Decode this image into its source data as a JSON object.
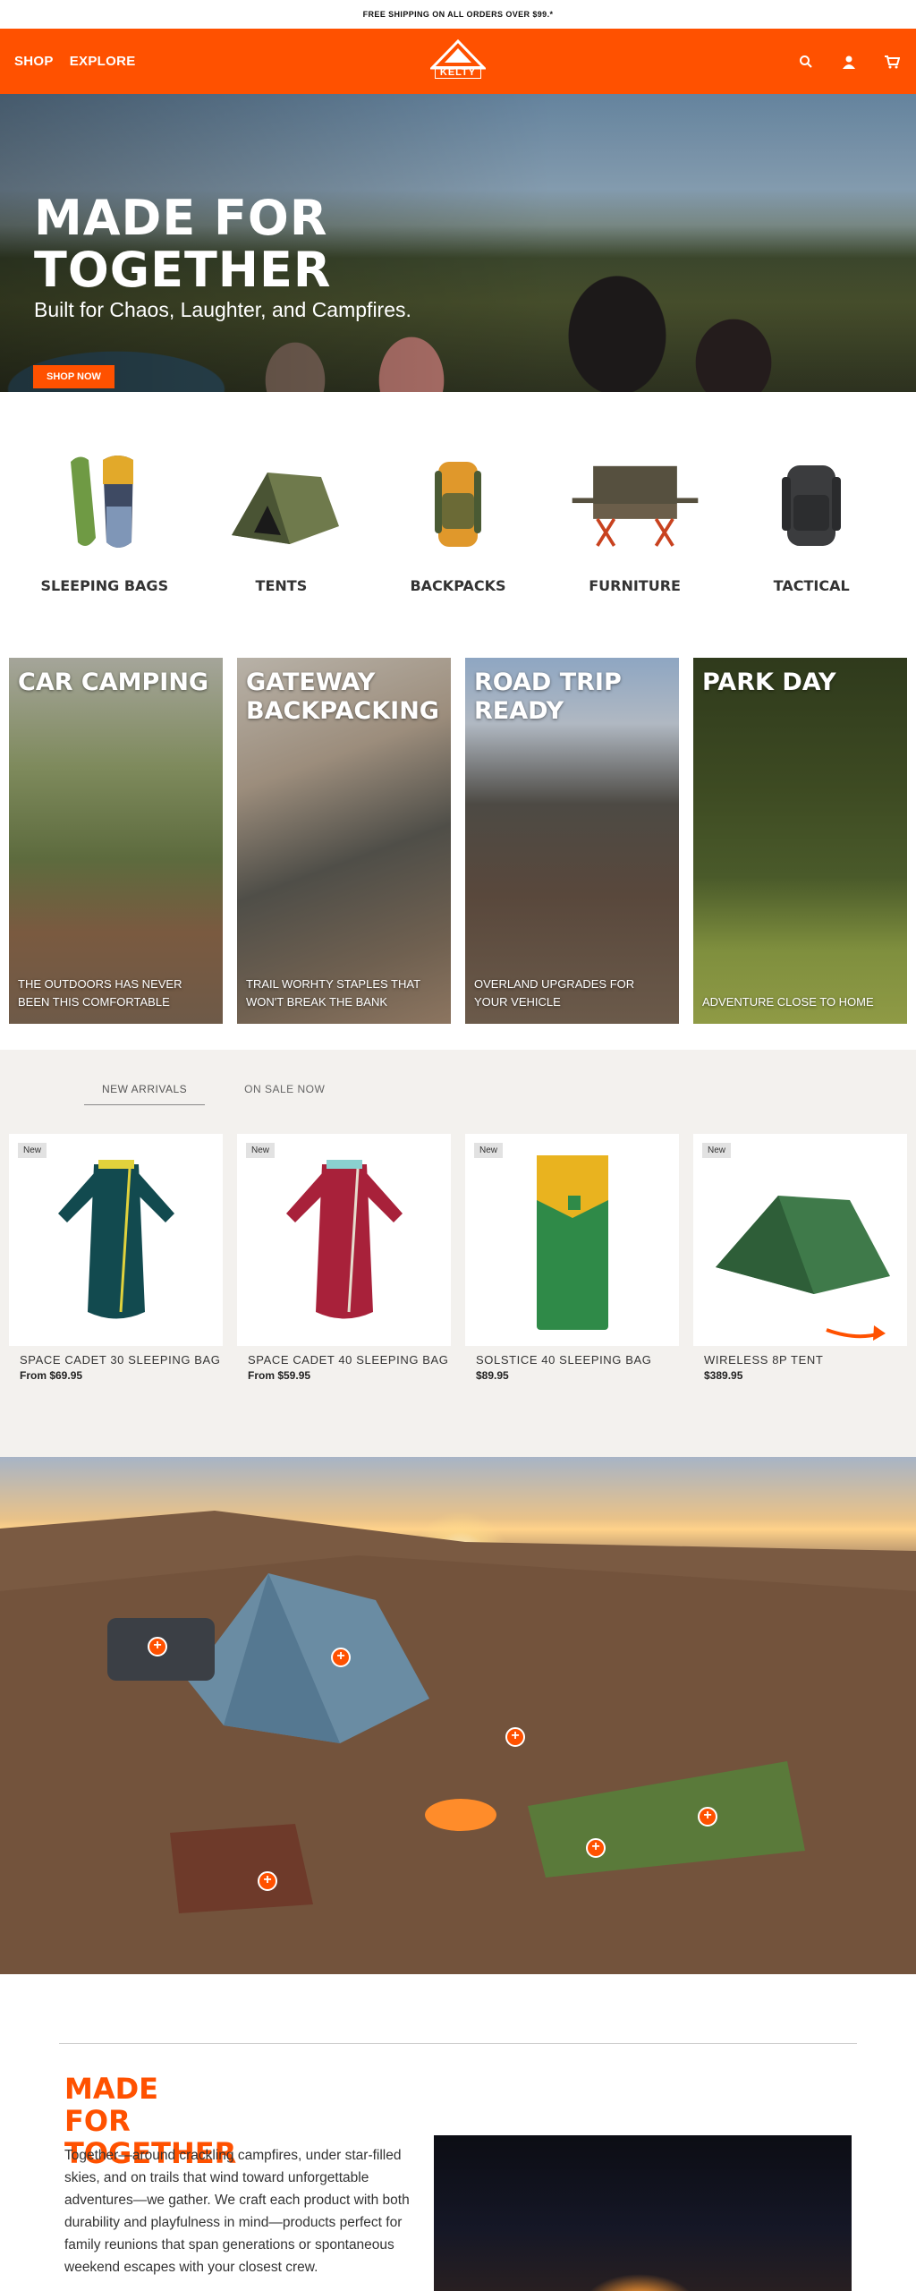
{
  "promo": {
    "text": "FREE SHIPPING ON ALL ORDERS OVER $99.*"
  },
  "header": {
    "nav": [
      {
        "label": "SHOP"
      },
      {
        "label": "EXPLORE"
      }
    ],
    "logo": {
      "text": "KELTY"
    },
    "icons": [
      "search-icon",
      "account-icon",
      "cart-icon"
    ],
    "brand_color": "#ff5100"
  },
  "hero": {
    "title": "MADE FOR TOGETHER",
    "subtitle": "Built for Chaos, Laughter, and Campfires.",
    "cta": "SHOP NOW"
  },
  "categories": [
    {
      "label": "SLEEPING BAGS"
    },
    {
      "label": "TENTS"
    },
    {
      "label": "BACKPACKS"
    },
    {
      "label": "FURNITURE"
    },
    {
      "label": "TACTICAL"
    }
  ],
  "activities": [
    {
      "title": "CAR CAMPING",
      "desc": "THE OUTDOORS HAS NEVER BEEN THIS COMFORTABLE"
    },
    {
      "title": "GATEWAY BACKPACKING",
      "desc": "TRAIL WORHTY STAPLES THAT WON'T BREAK THE BANK"
    },
    {
      "title": "ROAD TRIP READY",
      "desc": "OVERLAND UPGRADES FOR YOUR VEHICLE"
    },
    {
      "title": "PARK DAY",
      "desc": "ADVENTURE CLOSE TO HOME"
    }
  ],
  "products": {
    "tabs": [
      {
        "label": "NEW ARRIVALS"
      },
      {
        "label": "ON SALE NOW"
      }
    ],
    "items": [
      {
        "badge": "New",
        "name": "SPACE CADET 30 SLEEPING BAG",
        "price": "From $69.95"
      },
      {
        "badge": "New",
        "name": "SPACE CADET 40 SLEEPING BAG",
        "price": "From $59.95"
      },
      {
        "badge": "New",
        "name": "SOLSTICE 40 SLEEPING BAG",
        "price": "$89.95"
      },
      {
        "badge": "New",
        "name": "WIRELESS 8P TENT",
        "price": "$389.95"
      }
    ]
  },
  "story": {
    "title": "MADE FOR TOGETHER",
    "text": "Together—around crackling campfires, under star-filled skies, and on trails that wind toward unforgettable adventures—we gather. We craft each product with both durability and playfulness in mind—products perfect for family reunions that span generations or spontaneous weekend escapes with your closest crew."
  }
}
